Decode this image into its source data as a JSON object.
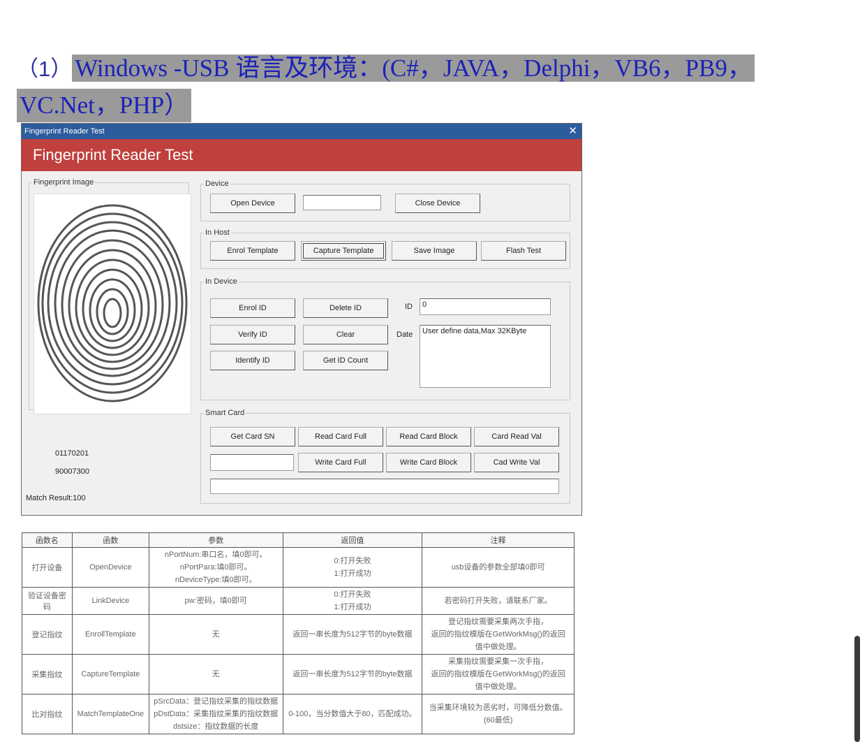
{
  "heading": {
    "num": "（1）",
    "line1": "Windows -USB 语言及环境：(C#，JAVA，Delphi，VB6，PB9，",
    "line2": "VC.Net，PHP）"
  },
  "window": {
    "title": "Fingerprint Reader Test",
    "close_glyph": "✕",
    "banner": "Fingerprint Reader Test",
    "fingerprint_group": "Fingerprint Image",
    "fp_code_1": "01170201",
    "fp_code_2": "90007300",
    "match_result": "Match Result:100",
    "device": {
      "legend": "Device",
      "open": "Open Device",
      "input_value": "",
      "close": "Close Device"
    },
    "in_host": {
      "legend": "In Host",
      "enrol_template": "Enrol Template",
      "capture_template": "Capture Template",
      "save_image": "Save Image",
      "flash_test": "Flash Test"
    },
    "in_device": {
      "legend": "In Device",
      "enrol_id": "Enrol ID",
      "delete_id": "Delete ID",
      "verify_id": "Verify ID",
      "clear": "Clear",
      "identify_id": "Identify ID",
      "get_id_count": "Get ID Count",
      "id_label": "ID",
      "id_value": "0",
      "date_label": "Date",
      "date_value": "User define data,Max 32KByte"
    },
    "smart_card": {
      "legend": "Smart Card",
      "get_card_sn": "Get Card SN",
      "read_card_full": "Read Card Full",
      "read_card_block": "Read Card Block",
      "card_read_val": "Card Read Val",
      "write_card_full": "Write Card Full",
      "write_card_block": "Write Card Block",
      "cad_write_val": "Cad Write Val",
      "sn_value": "",
      "status_value": ""
    }
  },
  "table": {
    "headers": [
      "函数名",
      "函数",
      "参数",
      "返回值",
      "注释"
    ],
    "rows": [
      {
        "name": "打开设备",
        "func": "OpenDevice",
        "params": [
          "nPortNum:串口名，填0即可。",
          "nPortPara:填0即可。",
          "nDeviceType:填0即可。"
        ],
        "ret": [
          "0:打开失败",
          "1:打开成功"
        ],
        "note": [
          "usb设备的参数全部填0即可"
        ]
      },
      {
        "name": "验证设备密码",
        "func": "LinkDevice",
        "params": [
          "pw:密码，填0即可"
        ],
        "ret": [
          "0:打开失败",
          "1:打开成功"
        ],
        "note": [
          "若密码打开失败，请联系厂家。"
        ]
      },
      {
        "name": "登记指纹",
        "func": "EnrollTemplate",
        "params": [
          "无"
        ],
        "ret": [
          "返回一串长度为512字节的byte数据"
        ],
        "note": [
          "登记指纹需要采集两次手指，",
          "返回的指纹模版在GetWorkMsg()的返回",
          "值中做处理。"
        ]
      },
      {
        "name": "采集指纹",
        "func": "CaptureTemplate",
        "params": [
          "无"
        ],
        "ret": [
          "返回一串长度为512字节的byte数据"
        ],
        "note": [
          "采集指纹需要采集一次手指，",
          "返回的指纹模版在GetWorkMsg()的返回",
          "值中做处理。"
        ]
      },
      {
        "name": "比对指纹",
        "func": "MatchTemplateOne",
        "params": [
          "pSrcData：登记指纹采集的指纹数据",
          "pDstData：采集指纹采集的指纹数据",
          "dstsize：指纹数据的长度"
        ],
        "ret": [
          "0-100，当分数值大于80，匹配成功。"
        ],
        "note": [
          "当采集环境较为恶劣时，可降低分数值。",
          "(60最低)"
        ]
      }
    ]
  }
}
